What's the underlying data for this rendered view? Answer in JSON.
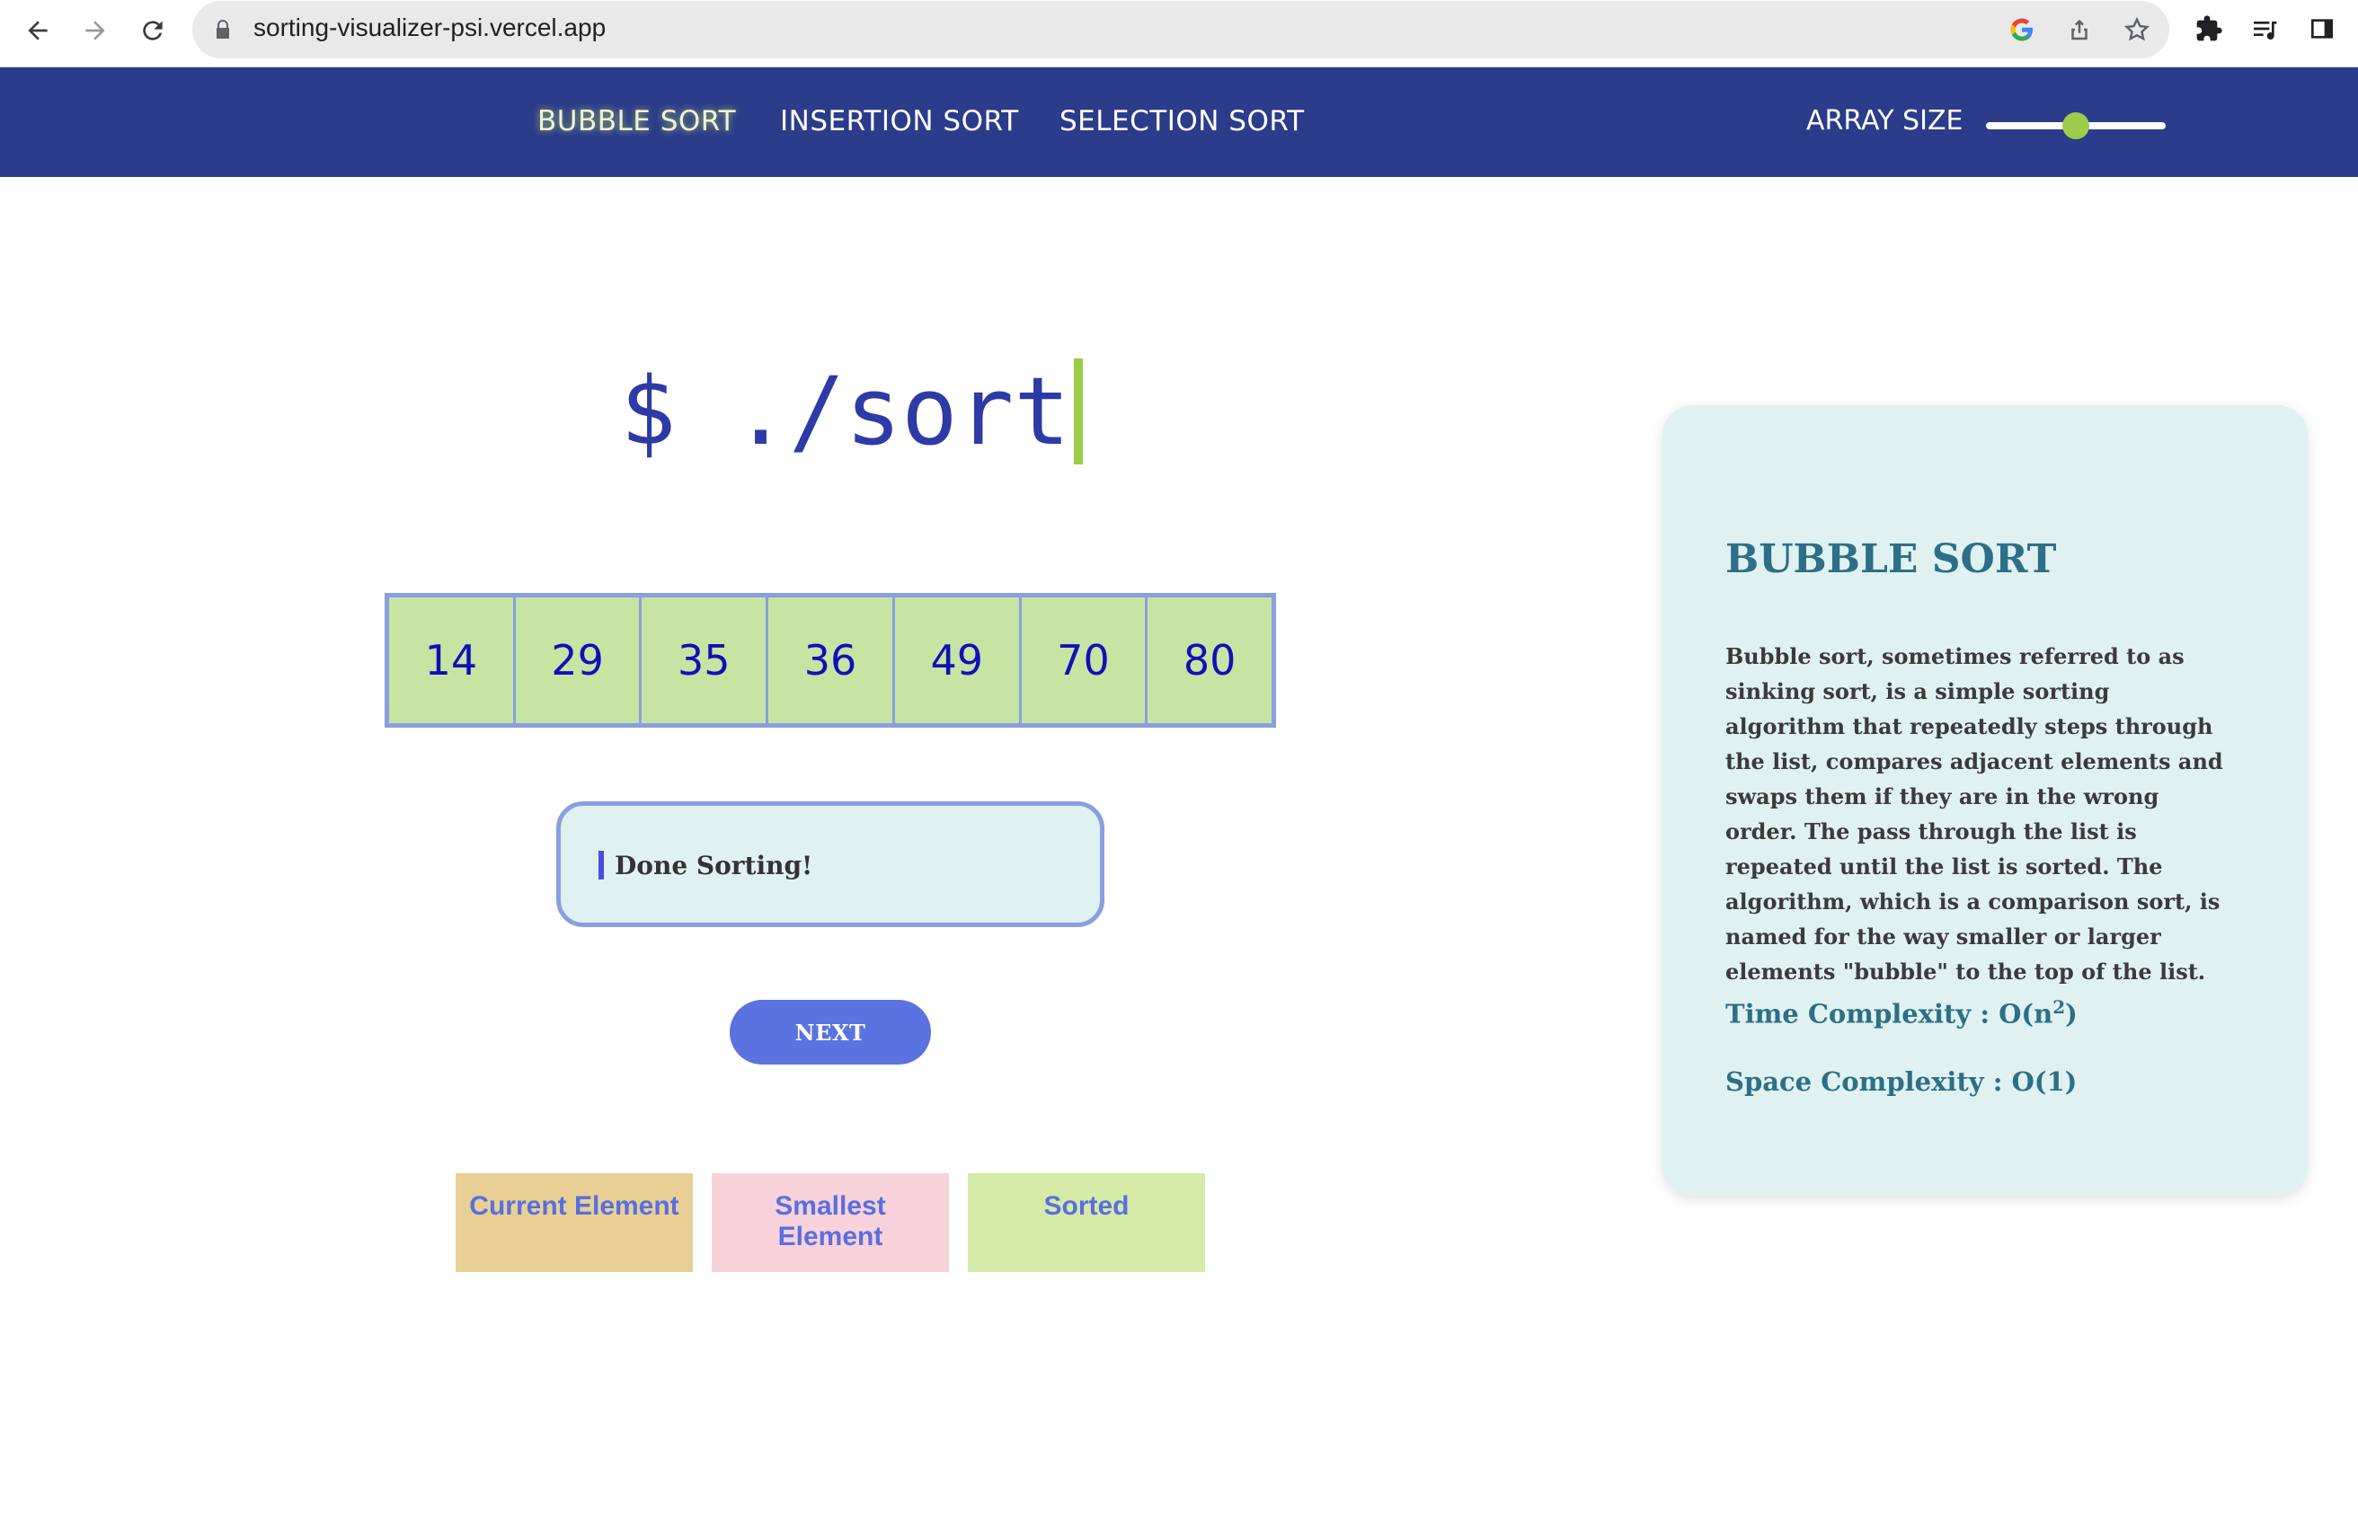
{
  "browser": {
    "url": "sorting-visualizer-psi.vercel.app"
  },
  "nav": {
    "links": [
      "BUBBLE SORT",
      "INSERTION SORT",
      "SELECTION SORT"
    ],
    "active": "BUBBLE SORT",
    "array_size_label": "ARRAY SIZE",
    "array_size_value": 0.5,
    "colors": {
      "bar": "#2a3c8a",
      "accent": "#9ccc4a"
    }
  },
  "terminal": {
    "prompt": "$ ./sort"
  },
  "array": {
    "values": [
      "14",
      "29",
      "35",
      "36",
      "49",
      "70",
      "80"
    ]
  },
  "status": {
    "message": "Done Sorting!"
  },
  "controls": {
    "next_label": "NEXT"
  },
  "legend": [
    {
      "label": "Current Element",
      "color": "#e8d095"
    },
    {
      "label": "Smallest Element",
      "color": "#f7d2da"
    },
    {
      "label": "Sorted",
      "color": "#d6eba7"
    }
  ],
  "info": {
    "title": "BUBBLE SORT",
    "description": "Bubble sort, sometimes referred to as sinking sort, is a simple sorting algorithm that repeatedly steps through the list, compares adjacent elements and swaps them if they are in the wrong order. The pass through the list is repeated until the list is sorted. The algorithm, which is a comparison sort, is named for the way smaller or larger elements \"bubble\" to the top of the list.",
    "time_label": "Time Complexity : O(n",
    "time_exp": "2",
    "time_close": ")",
    "space_label": "Space Complexity : O(1)"
  }
}
